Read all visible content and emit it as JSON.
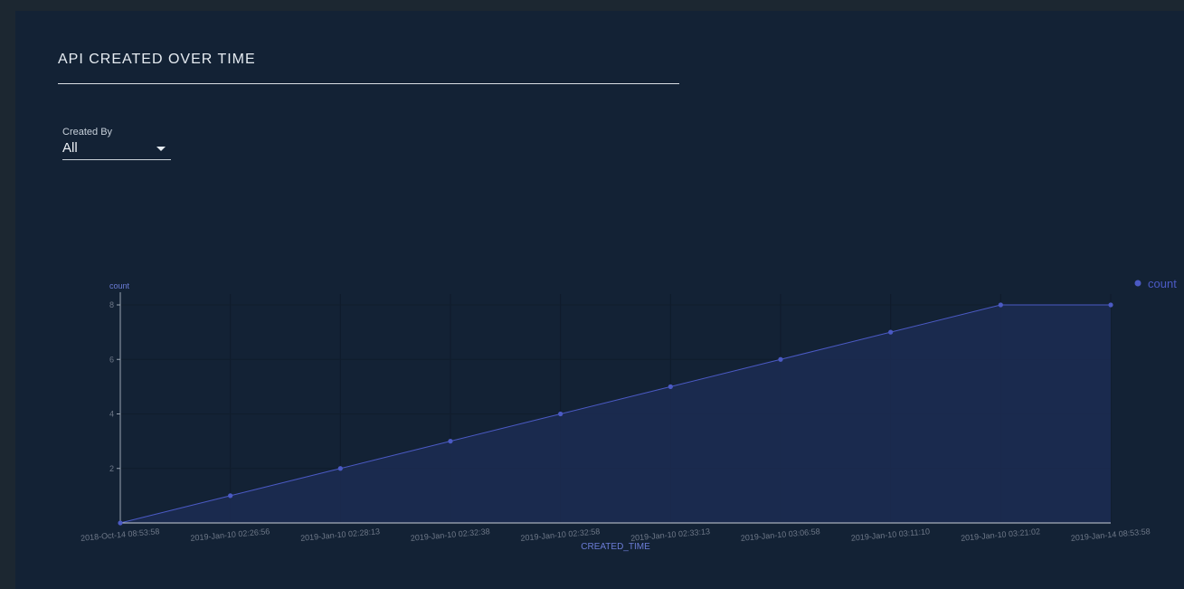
{
  "header": {
    "title": "API CREATED OVER TIME"
  },
  "filter": {
    "label": "Created By",
    "value": "All"
  },
  "colors": {
    "series": "#4b5ac4",
    "fill": "#1c2b52",
    "axis": "#9aa4b1",
    "tick_text": "#6e7888",
    "label_text": "#6b7cd6"
  },
  "chart_data": {
    "type": "area",
    "x": [
      "2018-Oct-14 08:53:58",
      "2019-Jan-10 02:26:56",
      "2019-Jan-10 02:28:13",
      "2019-Jan-10 02:32:38",
      "2019-Jan-10 02:32:58",
      "2019-Jan-10 02:33:13",
      "2019-Jan-10 03:06:58",
      "2019-Jan-10 03:11:10",
      "2019-Jan-10 03:21:02",
      "2019-Jan-14 08:53:58"
    ],
    "series": [
      {
        "name": "count",
        "values": [
          0,
          1,
          2,
          3,
          4,
          5,
          6,
          7,
          8,
          8
        ]
      }
    ],
    "xlabel": "CREATED_TIME",
    "ylabel": "count",
    "ylim": [
      0,
      8
    ],
    "yticks": [
      "2",
      "4",
      "6",
      "8"
    ],
    "grid": true,
    "legend": "top-right"
  }
}
